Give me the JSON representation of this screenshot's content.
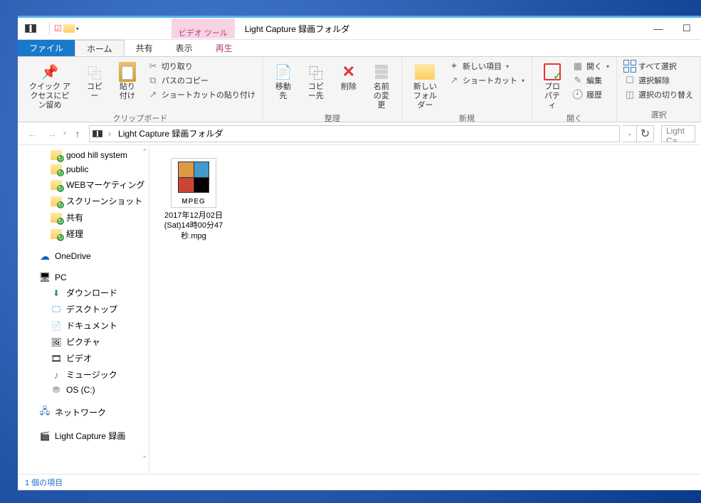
{
  "titlebar": {
    "contextual_label": "ビデオ ツール",
    "window_title": "Light Capture 録画フォルダ",
    "minimize": "—",
    "maximize": "☐"
  },
  "tabs": {
    "file": "ファイル",
    "home": "ホーム",
    "share": "共有",
    "view": "表示",
    "play": "再生"
  },
  "ribbon": {
    "quick_access": "クイック アクセスにピン留め",
    "copy": "コピー",
    "paste": "貼り付け",
    "cut": "切り取り",
    "copy_path": "パスのコピー",
    "paste_shortcut": "ショートカットの貼り付け",
    "group_clipboard": "クリップボード",
    "move_to": "移動先",
    "copy_to": "コピー先",
    "delete": "削除",
    "rename": "名前の変更",
    "group_organize": "整理",
    "new_folder": "新しいフォルダー",
    "new_item": "新しい項目",
    "shortcut": "ショートカット",
    "group_new": "新規",
    "properties": "プロパティ",
    "open": "開く",
    "edit": "編集",
    "history": "履歴",
    "group_open": "開く",
    "select_all": "すべて選択",
    "select_none": "選択解除",
    "invert_selection": "選択の切り替え",
    "group_select": "選択"
  },
  "address": {
    "segment1": "Light Capture 録画フォルダ",
    "search_placeholder": "Light Ca"
  },
  "nav": {
    "items": [
      {
        "label": "good hill system",
        "icon": "folder sync",
        "sub": true
      },
      {
        "label": "public",
        "icon": "folder sync",
        "sub": true
      },
      {
        "label": "WEBマーケティング",
        "icon": "folder sync",
        "sub": true
      },
      {
        "label": "スクリーンショット",
        "icon": "folder sync",
        "sub": true
      },
      {
        "label": "共有",
        "icon": "folder sync",
        "sub": true
      },
      {
        "label": "経理",
        "icon": "folder sync",
        "sub": true
      }
    ],
    "onedrive": "OneDrive",
    "pc": "PC",
    "pc_items": [
      {
        "label": "ダウンロード",
        "icon": "dl"
      },
      {
        "label": "デスクトップ",
        "icon": "desk"
      },
      {
        "label": "ドキュメント",
        "icon": "doc"
      },
      {
        "label": "ピクチャ",
        "icon": "pic"
      },
      {
        "label": "ビデオ",
        "icon": "vid"
      },
      {
        "label": "ミュージック",
        "icon": "music"
      },
      {
        "label": "OS (C:)",
        "icon": "drive"
      }
    ],
    "network": "ネットワーク",
    "capture": "Light Capture 録画"
  },
  "files": [
    {
      "name": "2017年12月02日(Sat)14時00分47秒.mpg",
      "tag": "MPEG"
    }
  ],
  "status": {
    "text": "1 個の項目"
  }
}
